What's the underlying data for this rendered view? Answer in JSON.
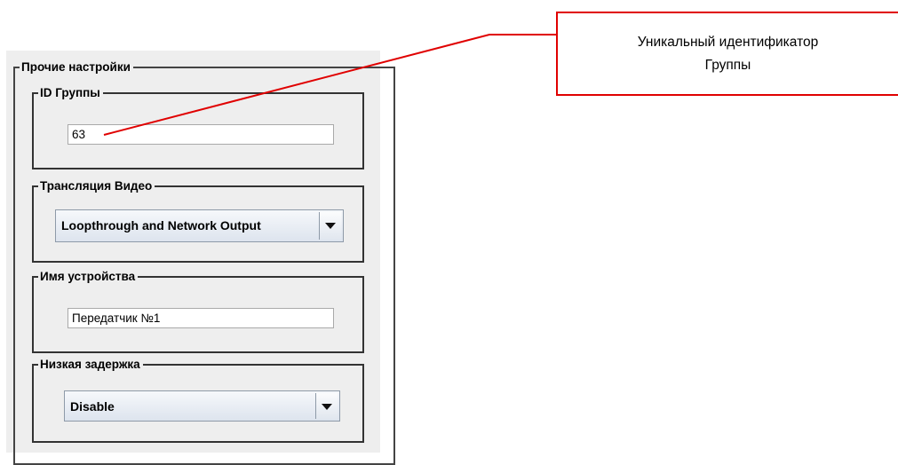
{
  "settings": {
    "title": "Прочие настройки",
    "group_id": {
      "label": "ID Группы",
      "value": "63"
    },
    "video": {
      "label": "Трансляция Видео",
      "selected": "Loopthrough and Network Output"
    },
    "device_name": {
      "label": "Имя устройства",
      "value": "Передатчик №1"
    },
    "low_latency": {
      "label": "Низкая задержка",
      "selected": "Disable"
    }
  },
  "callout": {
    "line1": "Уникальный идентификатор",
    "line2": "Группы",
    "color": "#e00000"
  },
  "icons": {
    "dropdown": "chevron-down-icon"
  }
}
